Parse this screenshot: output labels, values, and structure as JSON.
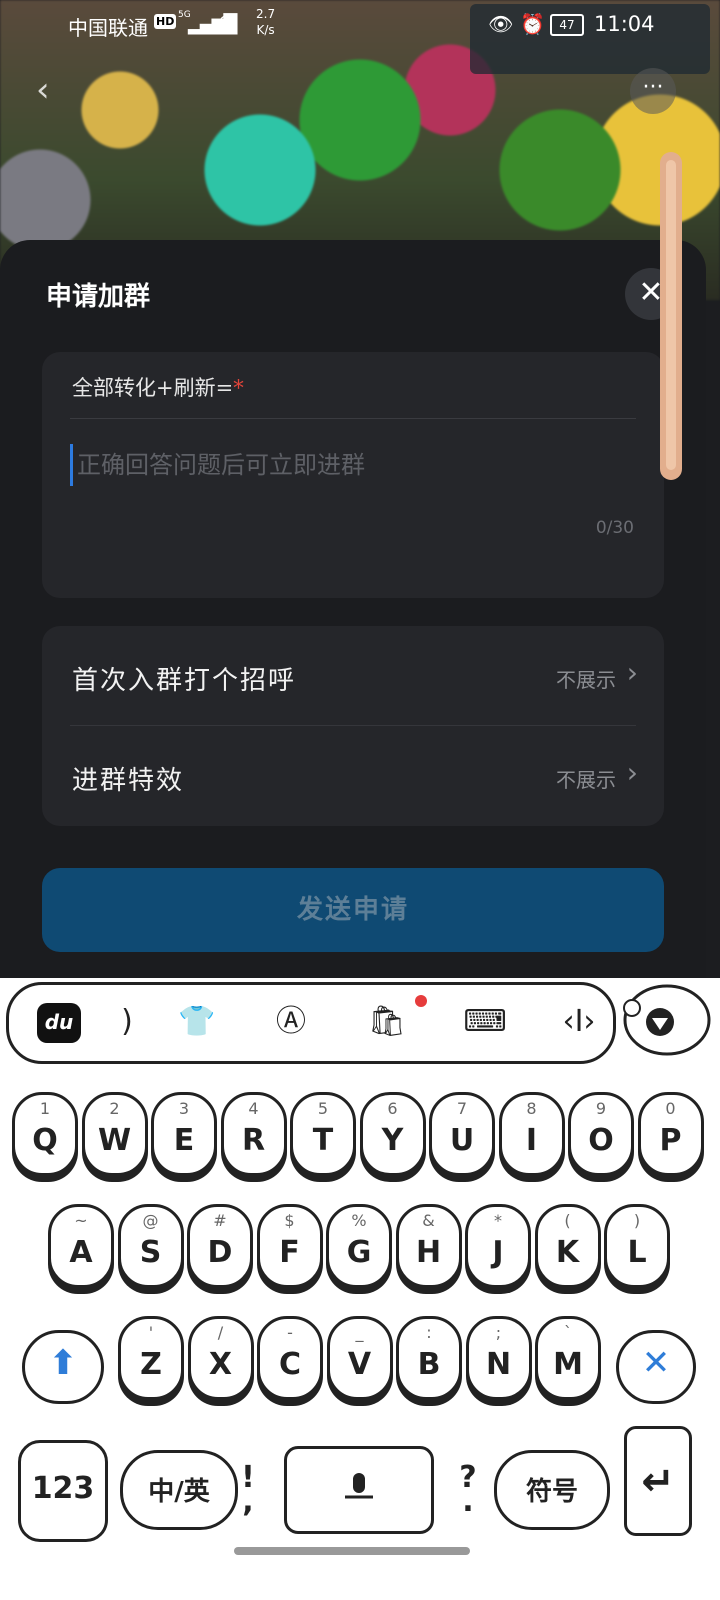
{
  "status_bar": {
    "carrier": "中国联通",
    "hd_badge": "HD",
    "network": "5G",
    "speed_value": "2.7",
    "speed_unit": "K/s",
    "battery": "47",
    "time": "11:04"
  },
  "sheet": {
    "title": "申请加群",
    "question_label": "全部转化+刷新=",
    "required_mark": "*",
    "answer_placeholder": "正确回答问题后可立即进群",
    "answer_value": "",
    "char_counter": "0/30",
    "options": [
      {
        "label": "首次入群打个招呼",
        "value": "不展示"
      },
      {
        "label": "进群特效",
        "value": "不展示"
      }
    ],
    "submit_label": "发送申请"
  },
  "keyboard": {
    "toolbar_icons": [
      "du-logo-icon",
      "bracket-icon",
      "tshirt-icon",
      "sparkle-a-icon",
      "shopping-bag-icon",
      "keyboard-icon",
      "cursor-move-icon"
    ],
    "row1": [
      {
        "hint": "1",
        "key": "Q"
      },
      {
        "hint": "2",
        "key": "W"
      },
      {
        "hint": "3",
        "key": "E"
      },
      {
        "hint": "4",
        "key": "R"
      },
      {
        "hint": "5",
        "key": "T"
      },
      {
        "hint": "6",
        "key": "Y"
      },
      {
        "hint": "7",
        "key": "U"
      },
      {
        "hint": "8",
        "key": "I"
      },
      {
        "hint": "9",
        "key": "O"
      },
      {
        "hint": "0",
        "key": "P"
      }
    ],
    "row2": [
      {
        "hint": "~",
        "key": "A"
      },
      {
        "hint": "@",
        "key": "S"
      },
      {
        "hint": "#",
        "key": "D"
      },
      {
        "hint": "$",
        "key": "F"
      },
      {
        "hint": "%",
        "key": "G"
      },
      {
        "hint": "&",
        "key": "H"
      },
      {
        "hint": "*",
        "key": "J"
      },
      {
        "hint": "(",
        "key": "K"
      },
      {
        "hint": ")",
        "key": "L"
      }
    ],
    "row3": [
      {
        "hint": "'",
        "key": "Z"
      },
      {
        "hint": "/",
        "key": "X"
      },
      {
        "hint": "-",
        "key": "C"
      },
      {
        "hint": "_",
        "key": "V"
      },
      {
        "hint": ":",
        "key": "B"
      },
      {
        "hint": ";",
        "key": "N"
      },
      {
        "hint": "`",
        "key": "M"
      }
    ],
    "numbers_key": "123",
    "lang_key": "中/英",
    "exclaim_key": "!",
    "comma_key": ",",
    "question_key": "?",
    "period_key": ".",
    "symbols_key": "符号"
  }
}
